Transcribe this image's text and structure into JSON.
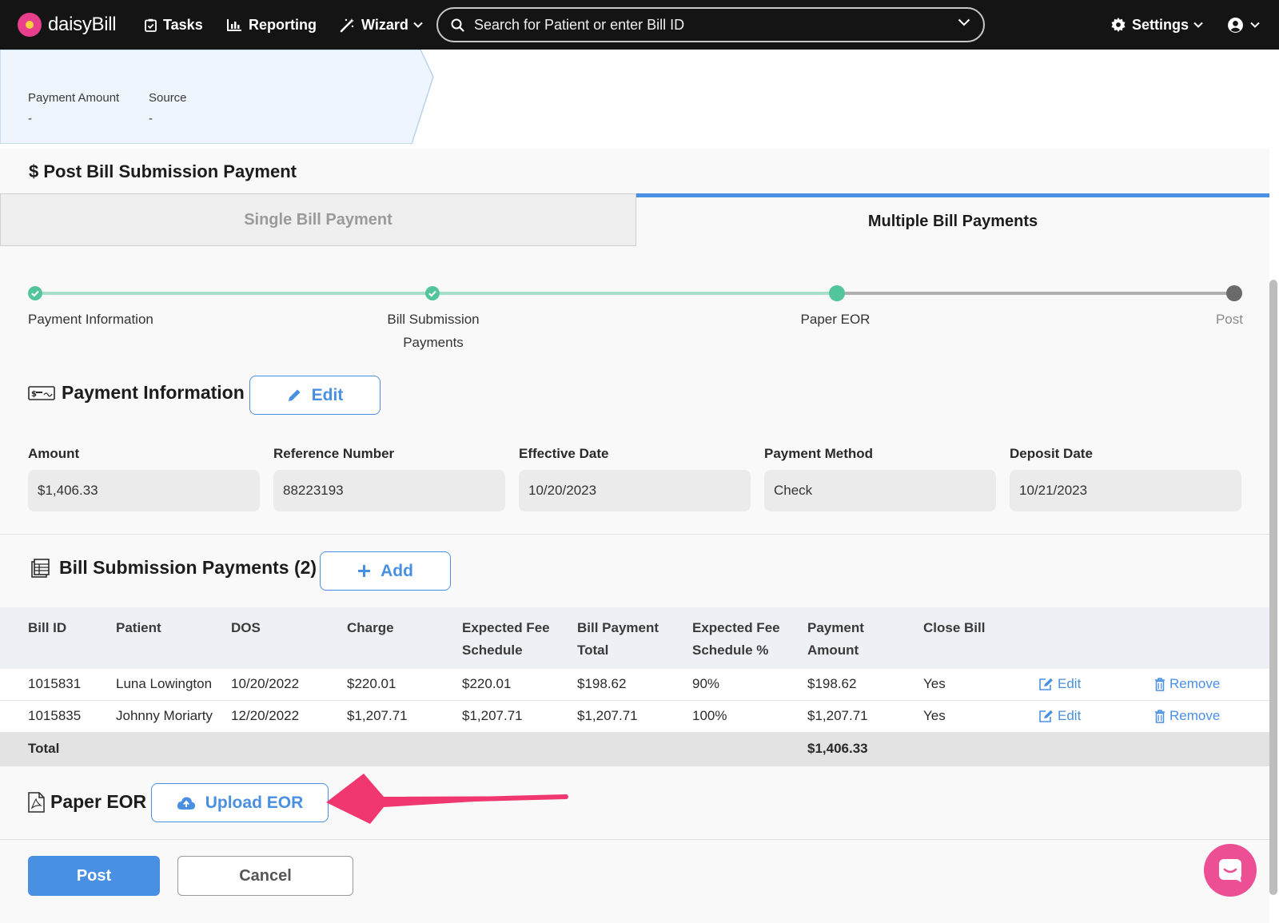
{
  "nav": {
    "logo_text": "daisyBill",
    "tasks": "Tasks",
    "reporting": "Reporting",
    "wizard": "Wizard",
    "search_placeholder": "Search for Patient or enter Bill ID",
    "settings": "Settings"
  },
  "summary": {
    "payment_amount_label": "Payment Amount",
    "payment_amount_value": "-",
    "source_label": "Source",
    "source_value": "-"
  },
  "page_title": "$ Post Bill Submission Payment",
  "tabs": {
    "single": "Single Bill Payment",
    "multiple": "Multiple Bill Payments"
  },
  "stepper": {
    "steps": [
      {
        "label_line1": "Payment Information",
        "label_line2": "",
        "state": "complete"
      },
      {
        "label_line1": "Bill Submission",
        "label_line2": "Payments",
        "state": "complete"
      },
      {
        "label_line1": "Paper EOR",
        "label_line2": "",
        "state": "current"
      },
      {
        "label_line1": "Post",
        "label_line2": "",
        "state": "pending"
      }
    ]
  },
  "payment_info": {
    "title": "Payment Information",
    "edit_label": "Edit",
    "fields": [
      {
        "label": "Amount",
        "value": "$1,406.33"
      },
      {
        "label": "Reference Number",
        "value": "88223193"
      },
      {
        "label": "Effective Date",
        "value": "10/20/2023"
      },
      {
        "label": "Payment Method",
        "value": "Check"
      },
      {
        "label": "Deposit Date",
        "value": "10/21/2023"
      }
    ]
  },
  "bill_payments": {
    "title": "Bill Submission Payments (2)",
    "add_label": "Add",
    "headers": [
      {
        "line1": "Bill ID",
        "line2": ""
      },
      {
        "line1": "Patient",
        "line2": ""
      },
      {
        "line1": "DOS",
        "line2": ""
      },
      {
        "line1": "Charge",
        "line2": ""
      },
      {
        "line1": "Expected Fee",
        "line2": "Schedule"
      },
      {
        "line1": "Bill Payment",
        "line2": "Total"
      },
      {
        "line1": "Expected Fee",
        "line2": "Schedule %"
      },
      {
        "line1": "Payment",
        "line2": "Amount"
      },
      {
        "line1": "Close Bill",
        "line2": ""
      }
    ],
    "rows": [
      {
        "bill_id": "1015831",
        "patient": "Luna Lowington",
        "dos": "10/20/2022",
        "charge": "$220.01",
        "expected_fee": "$220.01",
        "bill_payment_total": "$198.62",
        "fee_pct": "90%",
        "payment_amount": "$198.62",
        "close_bill": "Yes",
        "edit": "Edit",
        "remove": "Remove"
      },
      {
        "bill_id": "1015835",
        "patient": "Johnny Moriarty",
        "dos": "12/20/2022",
        "charge": "$1,207.71",
        "expected_fee": "$1,207.71",
        "bill_payment_total": "$1,207.71",
        "fee_pct": "100%",
        "payment_amount": "$1,207.71",
        "close_bill": "Yes",
        "edit": "Edit",
        "remove": "Remove"
      }
    ],
    "total_label": "Total",
    "total_value": "$1,406.33"
  },
  "paper_eor": {
    "title": "Paper EOR",
    "upload_label": "Upload EOR"
  },
  "actions": {
    "post": "Post",
    "cancel": "Cancel"
  },
  "colors": {
    "accent": "#4a90e2",
    "step_complete": "#52c59a",
    "annotation_arrow": "#f0376f",
    "chat_bubble": "#ec4f93"
  }
}
